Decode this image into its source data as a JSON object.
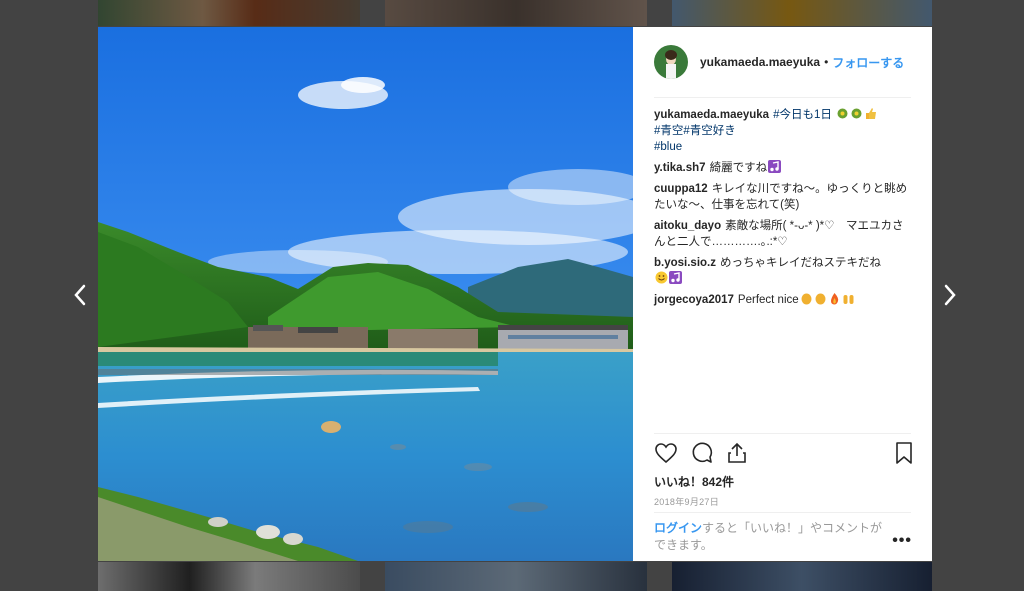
{
  "header": {
    "username": "yukamaeda.maeyuka",
    "separator": "•",
    "follow_label": "フォローする"
  },
  "caption": {
    "username": "yukamaeda.maeyuka",
    "text": "#今日も1日",
    "hashtags_line2": "#青空#青空好き",
    "hashtag_line3": "#blue",
    "emojis": [
      "clover-sparkle",
      "clover-sparkle",
      "thumbs-up"
    ]
  },
  "comments": [
    {
      "user": "y.tika.sh7",
      "text": "綺麗ですね",
      "emojis": [
        "music-note"
      ]
    },
    {
      "user": "cuuppa12",
      "text": "キレイな川ですね〜。ゆっくりと眺めたいな〜、仕事を忘れて(笑)",
      "emojis": []
    },
    {
      "user": "aitoku_dayo",
      "text": "素敵な場所( *-ᴗ-* )*♡　マエユカさんと二人で………….｡.:*♡",
      "emojis": []
    },
    {
      "user": "b.yosi.sio.z",
      "text": "めっちゃキレイだねステキだね",
      "emojis": [
        "smile",
        "music-note"
      ]
    },
    {
      "user": "jorgecoya2017",
      "text": "Perfect nice",
      "emojis": [
        "clap",
        "clap",
        "fire",
        "raised-hands"
      ]
    }
  ],
  "likes_label": "いいね！842件",
  "date": "2018年9月27日",
  "footer": {
    "login_link": "ログイン",
    "text": "すると「いいね！」やコメントができます。",
    "more_label": "•••"
  },
  "colors": {
    "accent": "#3897f0",
    "text": "#262626",
    "muted": "#999999",
    "overlay": "#7a7a7a"
  },
  "icons": {
    "prev": "chevron-left-icon",
    "next": "chevron-right-icon",
    "like": "heart-icon",
    "comment": "comment-bubble-icon",
    "share": "share-icon",
    "save": "bookmark-icon"
  }
}
